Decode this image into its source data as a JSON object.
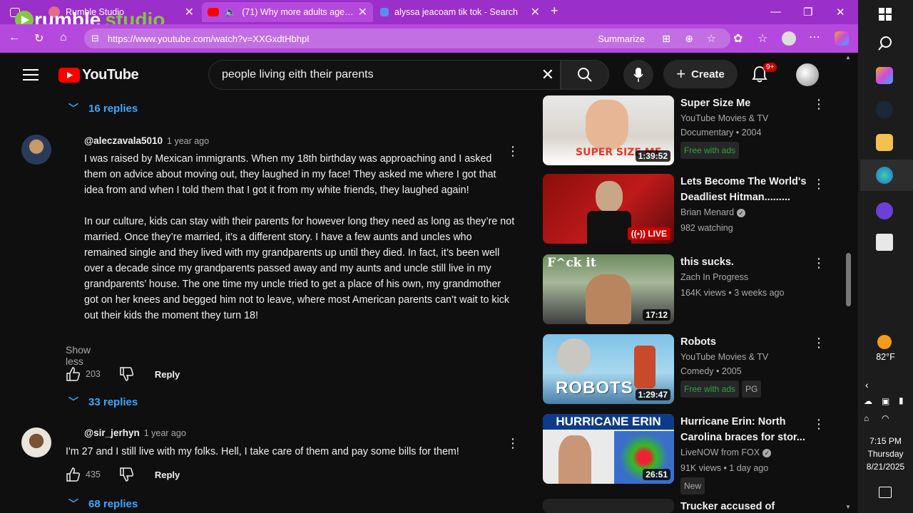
{
  "browser": {
    "tabs": [
      {
        "title": "Rumble Studio",
        "active": false
      },
      {
        "title": "(71) Why more adults age 2(",
        "active": true
      },
      {
        "title": "alyssa jeacoam tik tok - Search",
        "active": false
      }
    ],
    "url": "https://www.youtube.com/watch?v=XXGxdtHbhpI",
    "summarize_label": "Summarize",
    "new_tab": "+"
  },
  "watermark": {
    "brand": "rumble",
    "suffix": "studio"
  },
  "youtube": {
    "logo_text": "YouTube",
    "search_value": "people living eith their parents",
    "create_label": "Create",
    "notif_count": "9+"
  },
  "comments": {
    "top_replies": "16 replies",
    "c1": {
      "author": "@aleczavala5010",
      "time": "1 year ago",
      "p1": "I was raised by Mexican immigrants. When my 18th birthday was approaching and I asked them on advice about moving out, they laughed in my face! They asked me where I got that idea from and when I told them that I got it from my white friends, they laughed again!",
      "p2": "In our culture, kids can stay with their parents for however long they need as long as they’re not married. Once they’re married, it’s a different story. I have a few aunts and uncles who remained single and they lived with my grandparents up until they died. In fact, it’s been well over a decade since my grandparents passed away and my aunts and uncle still live in my grandparents’ house. The one time my uncle tried to get a place of his own, my grandmother got on her knees and begged him not to leave, where most American parents can’t wait to kick out their kids the moment they turn 18!",
      "show_less": "Show less",
      "likes": "203",
      "reply": "Reply",
      "replies": "33 replies"
    },
    "c2": {
      "author": "@sir_jerhyn",
      "time": "1 year ago",
      "text": "I'm 27 and I still live with my folks. Hell, I take care of them and pay some bills for them!",
      "likes": "435",
      "reply": "Reply",
      "replies": "68 replies"
    }
  },
  "sidebar": [
    {
      "title": "Super Size Me",
      "line1": "YouTube Movies & TV",
      "line2": "Documentary • 2004",
      "badges": [
        "Free with ads"
      ],
      "duration": "1:39:52",
      "thumb_text": "SUPER SIZE ME"
    },
    {
      "title": "Lets Become The World's Deadliest Hitman.........",
      "line1": "Brian Menard",
      "line2": "982 watching",
      "badges": [],
      "duration": "LIVE",
      "thumb_text": ""
    },
    {
      "title": "this sucks.",
      "line1": "Zach In Progress",
      "line2": "164K views • 3 weeks ago",
      "badges": [],
      "duration": "17:12",
      "thumb_text": "F^ck it"
    },
    {
      "title": "Robots",
      "line1": "YouTube Movies & TV",
      "line2": "Comedy • 2005",
      "badges": [
        "Free with ads",
        "PG"
      ],
      "duration": "1:29:47",
      "thumb_text": "ROBOTS"
    },
    {
      "title": "Hurricane Erin: North Carolina braces for stor...",
      "line1": "LiveNOW from FOX",
      "line2": "91K views • 1 day ago",
      "badges": [
        "New"
      ],
      "duration": "26:51",
      "thumb_text": "HURRICANE ERIN"
    },
    {
      "title": "Trucker accused of"
    }
  ],
  "taskbar": {
    "temp": "82°F",
    "time": "7:15 PM",
    "day": "Thursday",
    "date": "8/21/2025"
  },
  "colors": {
    "accent_purple": "#9b2fc9",
    "yt_red": "#ff0000",
    "link_blue": "#3ea6ff"
  }
}
